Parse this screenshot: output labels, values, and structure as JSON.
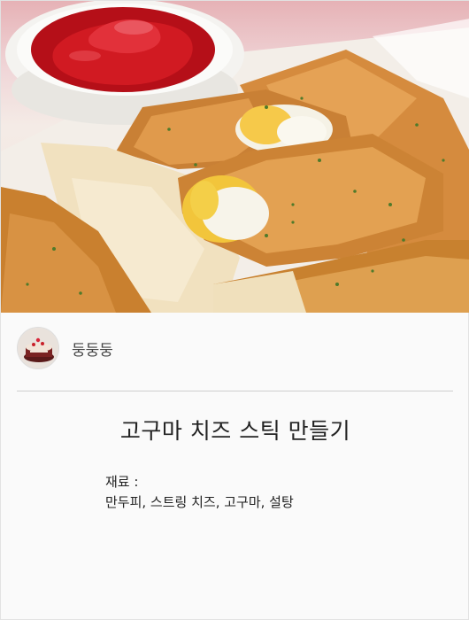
{
  "recipe_card": {
    "hero_image": {
      "subject": "cheese-stick-photo"
    },
    "author": {
      "name": "둥둥둥",
      "avatar": "cake-avatar"
    },
    "title": "고구마 치즈 스틱 만들기",
    "ingredients": {
      "label": "재료 :",
      "items_text": "만두피, 스트링 치즈, 고구마, 설탕"
    }
  },
  "colors": {
    "background": "#fafafa",
    "divider": "#cfcfcf",
    "text": "#222222",
    "ketchup": "#c8141c",
    "fried_crust": "#d98c3a",
    "cheese": "#f3efe0"
  }
}
